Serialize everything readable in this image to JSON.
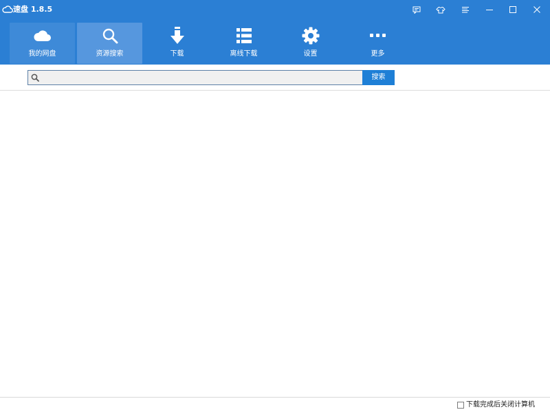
{
  "app": {
    "title": "速盘 1.8.5"
  },
  "window_controls": [
    {
      "name": "feedback-icon"
    },
    {
      "name": "skin-icon"
    },
    {
      "name": "menu-icon"
    },
    {
      "name": "minimize-icon"
    },
    {
      "name": "maximize-icon"
    },
    {
      "name": "close-icon"
    }
  ],
  "nav": {
    "items": [
      {
        "label": "我的网盘",
        "icon": "cloud-icon",
        "state": "faint"
      },
      {
        "label": "资源搜索",
        "icon": "search-icon",
        "state": "active"
      },
      {
        "label": "下载",
        "icon": "download-icon",
        "state": "normal"
      },
      {
        "label": "离线下载",
        "icon": "list-icon",
        "state": "normal"
      },
      {
        "label": "设置",
        "icon": "gear-icon",
        "state": "normal"
      },
      {
        "label": "更多",
        "icon": "more-icon",
        "state": "normal"
      }
    ]
  },
  "search": {
    "value": "",
    "placeholder": "",
    "button_label": "搜索"
  },
  "footer": {
    "shutdown_label": "下载完成后关闭计算机",
    "shutdown_checked": false
  },
  "colors": {
    "primary": "#2b7fd4",
    "active_tab": "#5697de",
    "search_button": "#1e7fd6"
  }
}
